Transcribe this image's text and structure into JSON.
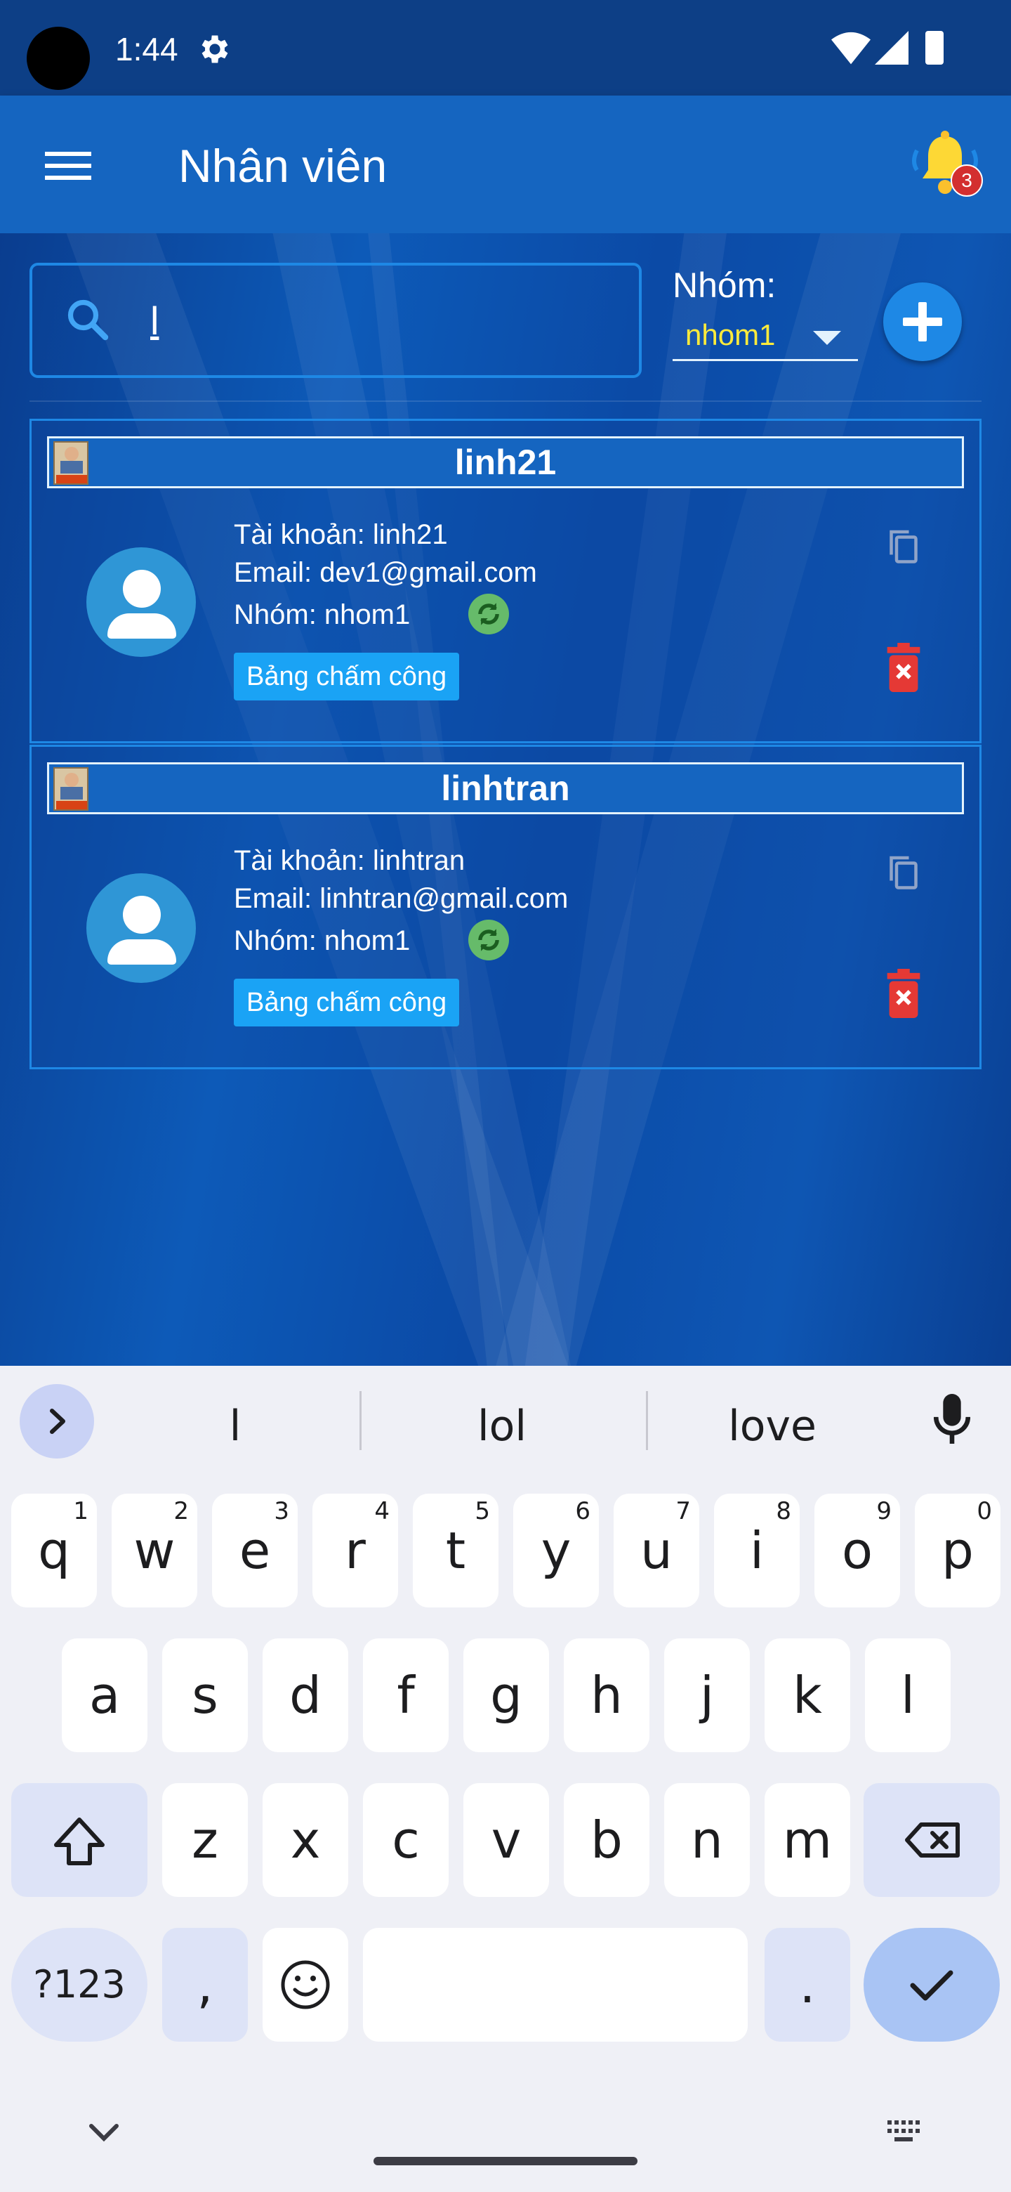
{
  "status_bar": {
    "time": "1:44"
  },
  "app_bar": {
    "title": "Nhân viên",
    "notification_count": "3"
  },
  "search": {
    "value": "l"
  },
  "group_filter": {
    "label": "Nhóm:",
    "selected": "nhom1"
  },
  "employees": [
    {
      "name": "linh21",
      "account_line": "Tài khoản: linh21",
      "email_line": "Email: dev1@gmail.com",
      "group_line": "Nhóm:  nhom1",
      "timesheet_label": "Bảng chấm công"
    },
    {
      "name": "linhtran",
      "account_line": "Tài khoản: linhtran",
      "email_line": "Email: linhtran@gmail.com",
      "group_line": "Nhóm:  nhom1",
      "timesheet_label": "Bảng chấm công"
    }
  ],
  "keyboard": {
    "suggestions": [
      "l",
      "lol",
      "love"
    ],
    "row1": [
      [
        "q",
        "1"
      ],
      [
        "w",
        "2"
      ],
      [
        "e",
        "3"
      ],
      [
        "r",
        "4"
      ],
      [
        "t",
        "5"
      ],
      [
        "y",
        "6"
      ],
      [
        "u",
        "7"
      ],
      [
        "i",
        "8"
      ],
      [
        "o",
        "9"
      ],
      [
        "p",
        "0"
      ]
    ],
    "row2": [
      "a",
      "s",
      "d",
      "f",
      "g",
      "h",
      "j",
      "k",
      "l"
    ],
    "row3": [
      "z",
      "x",
      "c",
      "v",
      "b",
      "n",
      "m"
    ],
    "symbols_label": "?123",
    "comma": ",",
    "period": "."
  },
  "colors": {
    "accent": "#1e88e5",
    "appbar": "#1565c0",
    "chip": "#1aa3f5",
    "delete": "#e53935",
    "sync": "#66bb6a",
    "group_value": "#ffeb3b"
  }
}
